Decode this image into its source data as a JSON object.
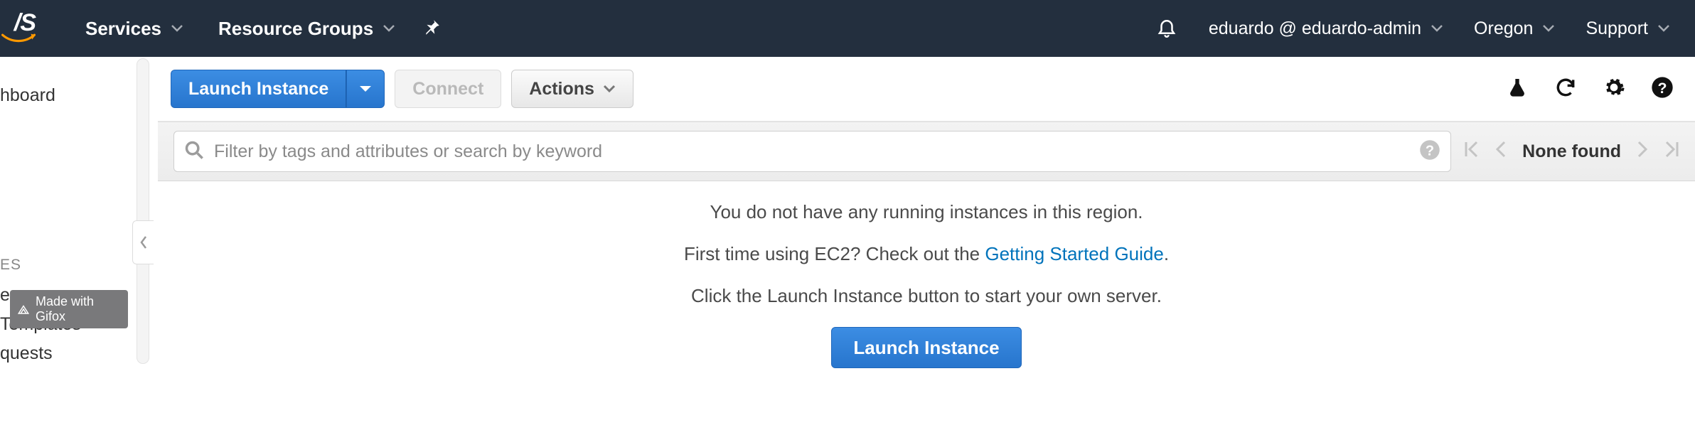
{
  "nav": {
    "services": "Services",
    "resource_groups": "Resource Groups",
    "account": "eduardo @ eduardo-admin",
    "region": "Oregon",
    "support": "Support"
  },
  "sidebar": {
    "items": [
      "hboard",
      "ES",
      "es",
      "Templates",
      "quests"
    ],
    "header_fragment": "ES"
  },
  "gifox": "Made with Gifox",
  "toolbar": {
    "launch": "Launch Instance",
    "connect": "Connect",
    "actions": "Actions"
  },
  "search": {
    "placeholder": "Filter by tags and attributes or search by keyword"
  },
  "pager": {
    "status": "None found"
  },
  "empty": {
    "line1": "You do not have any running instances in this region.",
    "line2a": "First time using EC2? Check out the ",
    "guide_link": "Getting Started Guide",
    "line2b": ".",
    "line3": "Click the Launch Instance button to start your own server.",
    "button": "Launch Instance"
  }
}
